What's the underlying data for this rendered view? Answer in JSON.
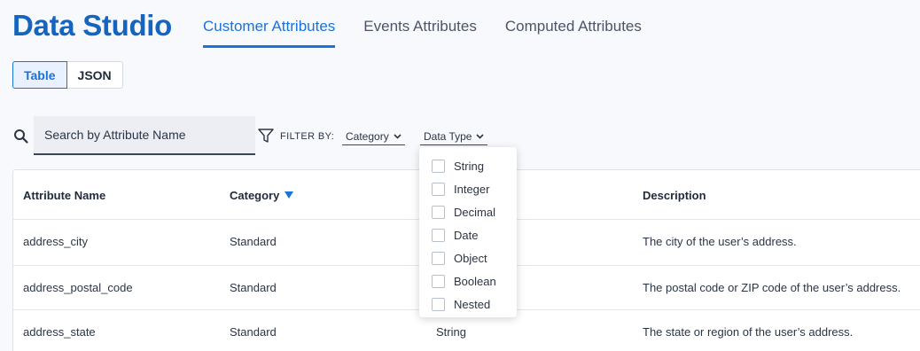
{
  "app": {
    "title": "Data Studio"
  },
  "tabs": [
    {
      "label": "Customer Attributes",
      "active": true
    },
    {
      "label": "Events Attributes",
      "active": false
    },
    {
      "label": "Computed Attributes",
      "active": false
    }
  ],
  "view_toggle": {
    "table_label": "Table",
    "json_label": "JSON",
    "selected": "Table"
  },
  "search": {
    "placeholder": "Search by Attribute Name",
    "value": ""
  },
  "filters": {
    "label": "FILTER BY:",
    "category_label": "Category",
    "data_type_label": "Data Type"
  },
  "data_type_menu": {
    "options": [
      "String",
      "Integer",
      "Decimal",
      "Date",
      "Object",
      "Boolean",
      "Nested"
    ]
  },
  "table": {
    "columns": [
      "Attribute Name",
      "Category",
      "",
      "Description"
    ],
    "rows": [
      {
        "name": "address_city",
        "category": "Standard",
        "data_type": "",
        "description": "The city of the user’s address."
      },
      {
        "name": "address_postal_code",
        "category": "Standard",
        "data_type": "",
        "description": "The postal code or ZIP code of the user’s address."
      },
      {
        "name": "address_state",
        "category": "Standard",
        "data_type": "String",
        "description": "The state or region of the user’s address."
      }
    ]
  },
  "colors": {
    "accent": "#1a73d9",
    "title": "#1565c0"
  },
  "icons": [
    "search-icon",
    "filter-icon",
    "chevron-down-icon",
    "sort-desc-icon"
  ]
}
